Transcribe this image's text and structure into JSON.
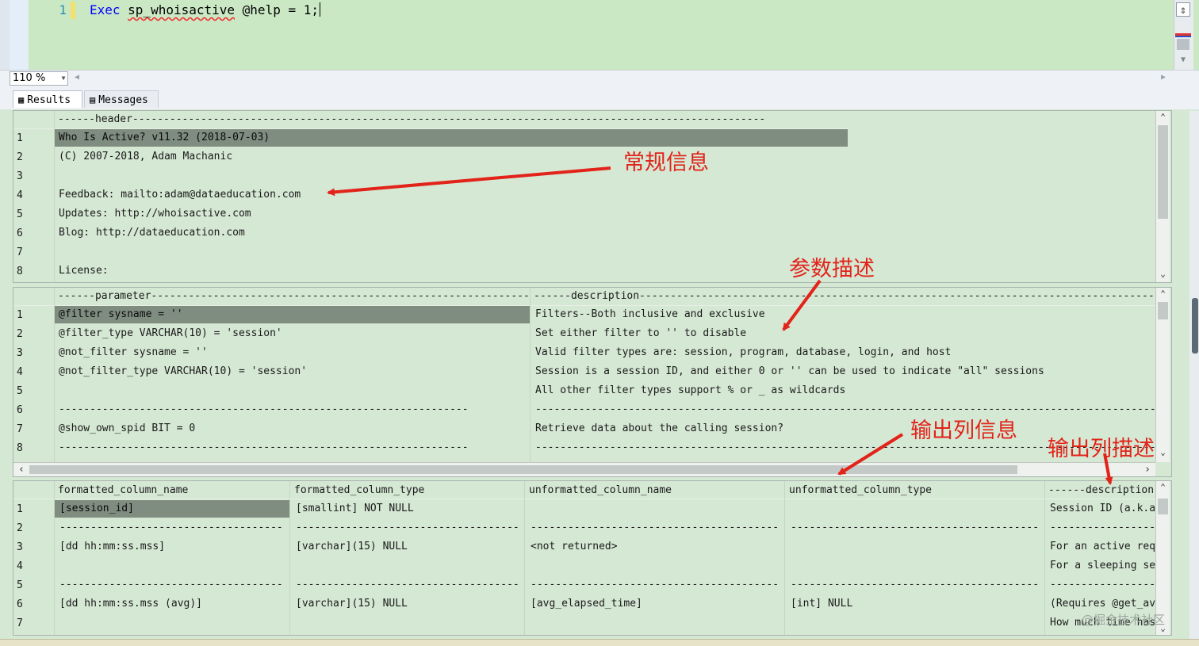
{
  "editor": {
    "line_number": "1",
    "code": {
      "keyword": "Exec",
      "proc": "sp_whoisactive",
      "rest": " @help = 1;"
    }
  },
  "zoom": {
    "value": "110 %"
  },
  "tabs": [
    {
      "label": "Results",
      "icon": "grid-icon"
    },
    {
      "label": "Messages",
      "icon": "messages-icon"
    }
  ],
  "grid1": {
    "header": "------header------------------------------------------------------------------------------------------------------",
    "rows": [
      {
        "n": "1",
        "text": "Who Is Active? v11.32 (2018-07-03)"
      },
      {
        "n": "2",
        "text": "(C) 2007-2018, Adam Machanic"
      },
      {
        "n": "3",
        "text": ""
      },
      {
        "n": "4",
        "text": "Feedback: mailto:adam@dataeducation.com"
      },
      {
        "n": "5",
        "text": "Updates: http://whoisactive.com"
      },
      {
        "n": "6",
        "text": "Blog: http://dataeducation.com"
      },
      {
        "n": "7",
        "text": ""
      },
      {
        "n": "8",
        "text": "License:"
      }
    ]
  },
  "grid2": {
    "headers": [
      "------parameter------------------------------------------------------------------",
      "------description---------------------------------------------------------------------------------------------------------------------"
    ],
    "rows": [
      {
        "n": "1",
        "c1": "@filter sysname = ''",
        "c2": "Filters--Both inclusive and exclusive"
      },
      {
        "n": "2",
        "c1": "@filter_type VARCHAR(10) = 'session'",
        "c2": "Set either filter to '' to disable"
      },
      {
        "n": "3",
        "c1": "@not_filter sysname = ''",
        "c2": "Valid filter types are: session, program, database, login, and host"
      },
      {
        "n": "4",
        "c1": "@not_filter_type VARCHAR(10) = 'session'",
        "c2": "Session is a session ID, and either 0 or '' can be used to indicate \"all\" sessions"
      },
      {
        "n": "5",
        "c1": "",
        "c2": "All other filter types support % or _ as wildcards"
      },
      {
        "n": "6",
        "c1": "------------------------------------------------------------------",
        "c2": "------------------------------------------------------------------------------------------------------------------------"
      },
      {
        "n": "7",
        "c1": "@show_own_spid BIT = 0",
        "c2": "Retrieve data about the calling session?"
      },
      {
        "n": "8",
        "c1": "------------------------------------------------------------------",
        "c2": "------------------------------------------------------------------------------------------------------------------------"
      }
    ]
  },
  "grid3": {
    "headers": [
      "formatted_column_name",
      "formatted_column_type",
      "unformatted_column_name",
      "unformatted_column_type",
      "------description"
    ],
    "rows": [
      {
        "n": "1",
        "c": [
          "[session_id]",
          "[smallint] NOT NULL",
          "",
          "",
          "Session ID (a.k.a"
        ]
      },
      {
        "n": "2",
        "c": [
          "-------------------------------------",
          "-------------------------------------",
          "-----------------------------------------",
          "-----------------------------------------",
          "-------------------"
        ]
      },
      {
        "n": "3",
        "c": [
          "[dd hh:mm:ss.mss]",
          "[varchar](15) NULL",
          "<not returned>",
          "",
          "For an active req"
        ]
      },
      {
        "n": "4",
        "c": [
          "",
          "",
          "",
          "",
          "For a sleeping se"
        ]
      },
      {
        "n": "5",
        "c": [
          "-------------------------------------",
          "-------------------------------------",
          "-----------------------------------------",
          "-----------------------------------------",
          "-------------------"
        ]
      },
      {
        "n": "6",
        "c": [
          "[dd hh:mm:ss.mss (avg)]",
          "[varchar](15) NULL",
          "[avg_elapsed_time]",
          "[int] NULL",
          "(Requires @get_av"
        ]
      },
      {
        "n": "7",
        "c": [
          "",
          "",
          "",
          "",
          "How much time has"
        ]
      }
    ]
  },
  "annotations": {
    "general_info": "常规信息",
    "param_desc": "参数描述",
    "output_col_info": "输出列信息",
    "output_col_desc": "输出列描述"
  },
  "watermark": "@掘金技术社区",
  "colors": {
    "grid_bg": "#d5e8d4",
    "selected_cell": "#7f8c80",
    "annotation": "#e2231a",
    "keyword": "#0000ff"
  }
}
